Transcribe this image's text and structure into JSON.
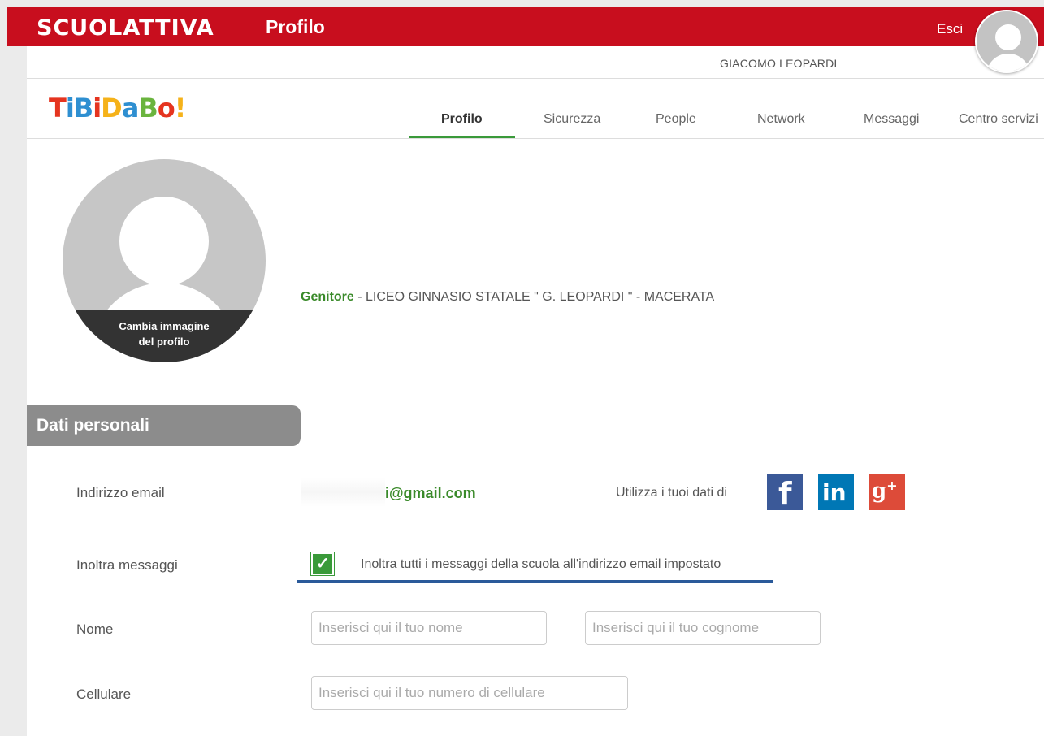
{
  "header": {
    "brand": "SCUOLATTIVA",
    "title": "Profilo",
    "logout_label": "Esci",
    "username": "GIACOMO LEOPARDI",
    "colors": {
      "bar": "#c80e1e"
    }
  },
  "logo": {
    "letters": [
      {
        "char": "T",
        "color": "#e5341f"
      },
      {
        "char": "i",
        "color": "#2e8fd1"
      },
      {
        "char": "B",
        "color": "#2e8fd1"
      },
      {
        "char": "i",
        "color": "#e5341f"
      },
      {
        "char": "D",
        "color": "#f5b21a"
      },
      {
        "char": "a",
        "color": "#2e8fd1"
      },
      {
        "char": "B",
        "color": "#6ab43e"
      },
      {
        "char": "o",
        "color": "#e5341f"
      },
      {
        "char": "!",
        "color": "#f5b21a"
      }
    ]
  },
  "nav": {
    "items": [
      {
        "label": "Profilo",
        "active": true
      },
      {
        "label": "Sicurezza",
        "active": false
      },
      {
        "label": "People",
        "active": false
      },
      {
        "label": "Network",
        "active": false
      },
      {
        "label": "Messaggi",
        "active": false
      },
      {
        "label": "Centro servizi",
        "active": false
      }
    ],
    "accent_color": "#3a9a3a"
  },
  "profile": {
    "change_picture_label_1": "Cambia immagine",
    "change_picture_label_2": "del profilo",
    "role": "Genitore",
    "school": " - LICEO GINNASIO STATALE \" G. LEOPARDI \" - MACERATA"
  },
  "personal_data": {
    "section_title": "Dati personali",
    "email_label": "Indirizzo email",
    "email_value": "i@gmail.com",
    "social_label": "Utilizza i tuoi dati di",
    "social_icons": [
      "facebook-icon",
      "linkedin-icon",
      "google-plus-icon"
    ],
    "forward_label": "Inoltra messaggi",
    "forward_checked": true,
    "forward_text": "Inoltra tutti i messaggi della scuola all'indirizzo email impostato",
    "name_label": "Nome",
    "first_name_placeholder": "Inserisci qui il tuo nome",
    "last_name_placeholder": "Inserisci qui il tuo cognome",
    "phone_label": "Cellulare",
    "phone_placeholder": "Inserisci qui il tuo numero di cellulare"
  }
}
